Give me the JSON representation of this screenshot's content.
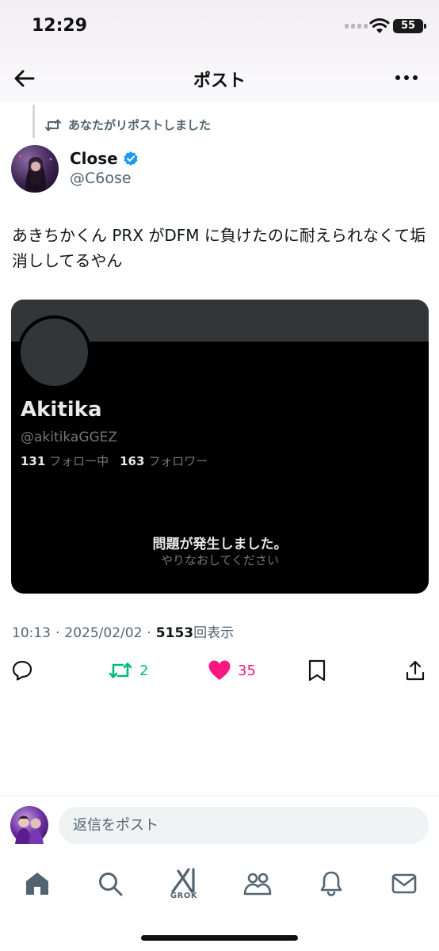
{
  "status_bar": {
    "time": "12:29",
    "battery": "55"
  },
  "nav": {
    "title": "ポスト"
  },
  "repost": {
    "text": "あなたがリポストしました"
  },
  "author": {
    "name": "Close",
    "handle": "@C6ose",
    "verified": true
  },
  "tweet": {
    "text": "あきちかくん PRX がDFM に負けたのに耐えられなくて垢消ししてるやん"
  },
  "embedded_profile": {
    "name": "Akitika",
    "handle": "@akitikaGGEZ",
    "following_count": "131",
    "following_label": "フォロー中",
    "followers_count": "163",
    "followers_label": "フォロワー",
    "error_title": "問題が発生しました。",
    "error_retry": "やりなおしてください"
  },
  "meta": {
    "time": "10:13",
    "separator": "·",
    "date": "2025/02/02",
    "views": "5153",
    "views_label": "回表示"
  },
  "actions": {
    "reposts": "2",
    "likes": "35",
    "repost_color": "#00ba7c",
    "like_color": "#f91880"
  },
  "reply": {
    "placeholder": "返信をポスト"
  },
  "tabbar": {
    "grok_label": "GROK"
  },
  "icons": [
    "back-arrow-icon",
    "more-icon",
    "repost-icon",
    "verified-badge-icon",
    "reply-icon",
    "retweet-icon",
    "heart-icon",
    "bookmark-icon",
    "share-icon",
    "home-icon",
    "search-icon",
    "grok-icon",
    "communities-icon",
    "bell-icon",
    "mail-icon"
  ]
}
